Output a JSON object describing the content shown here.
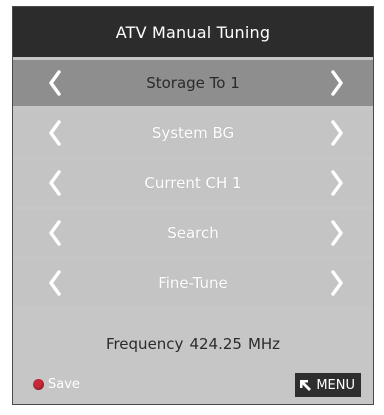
{
  "title": "ATV Manual Tuning",
  "rows": [
    {
      "label": "Storage To 1",
      "selected": true
    },
    {
      "label": "System BG",
      "selected": false
    },
    {
      "label": "Current CH 1",
      "selected": false
    },
    {
      "label": "Search",
      "selected": false
    },
    {
      "label": "Fine-Tune",
      "selected": false
    }
  ],
  "frequency": {
    "label": "Frequency",
    "value": "424.25",
    "unit": "MHz"
  },
  "footer": {
    "save_label": "Save",
    "menu_label": "MENU"
  },
  "icons": {
    "left": "chevron-left-icon",
    "right": "chevron-right-icon",
    "save": "red-dot-icon",
    "menu": "return-arrow-icon"
  },
  "colors": {
    "title_bg": "#2c2c2c",
    "panel_bg": "#c6c6c6",
    "selected_row_bg": "#8e8e8e",
    "save_dot": "#c8283a"
  }
}
